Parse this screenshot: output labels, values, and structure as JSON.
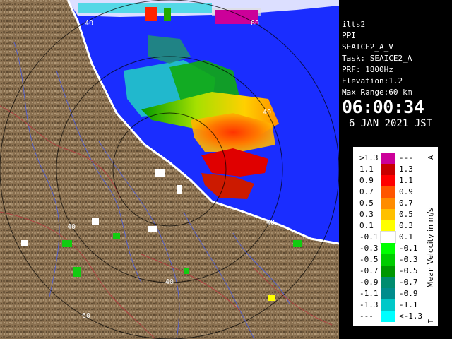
{
  "info_panel": {
    "lines": [
      "ilts2",
      "PPI",
      "SEAICE2_A_V",
      "Task: SEAICE2_A",
      "PRF: 1800Hz",
      "Elevation:1.2",
      "Max Range:60 km"
    ],
    "time": "06:00:34",
    "date": "6 JAN 2021 JST"
  },
  "range_rings": {
    "labels": [
      "40",
      "60",
      "40",
      "40",
      "40",
      "40",
      "60"
    ]
  },
  "legend": {
    "title": "Mean Velocity in m/s",
    "corner_top": "A",
    "corner_bottom": "T",
    "left_labels": [
      ">1.3",
      "1.1",
      "0.9",
      "0.7",
      "0.5",
      "0.3",
      "0.1",
      "-0.1",
      "-0.3",
      "-0.5",
      "-0.7",
      "-0.9",
      "-1.1",
      "-1.3",
      "---"
    ],
    "right_labels": [
      "---",
      "1.3",
      "1.1",
      "0.9",
      "0.7",
      "0.5",
      "0.3",
      "0.1",
      "-0.1",
      "-0.3",
      "-0.5",
      "-0.7",
      "-0.9",
      "-1.1",
      "<-1.3"
    ],
    "colors": [
      "#cc0099",
      "#c80000",
      "#ff0000",
      "#ff5500",
      "#ff8c00",
      "#ffc000",
      "#ffff00",
      "#ffffff",
      "#00ff00",
      "#00cc00",
      "#009600",
      "#008c6e",
      "#008c8c",
      "#00c8c8",
      "#00ffff"
    ]
  },
  "colors": {
    "sea": "#1a2dff",
    "land": "#8a7050",
    "ring": "#000000"
  }
}
